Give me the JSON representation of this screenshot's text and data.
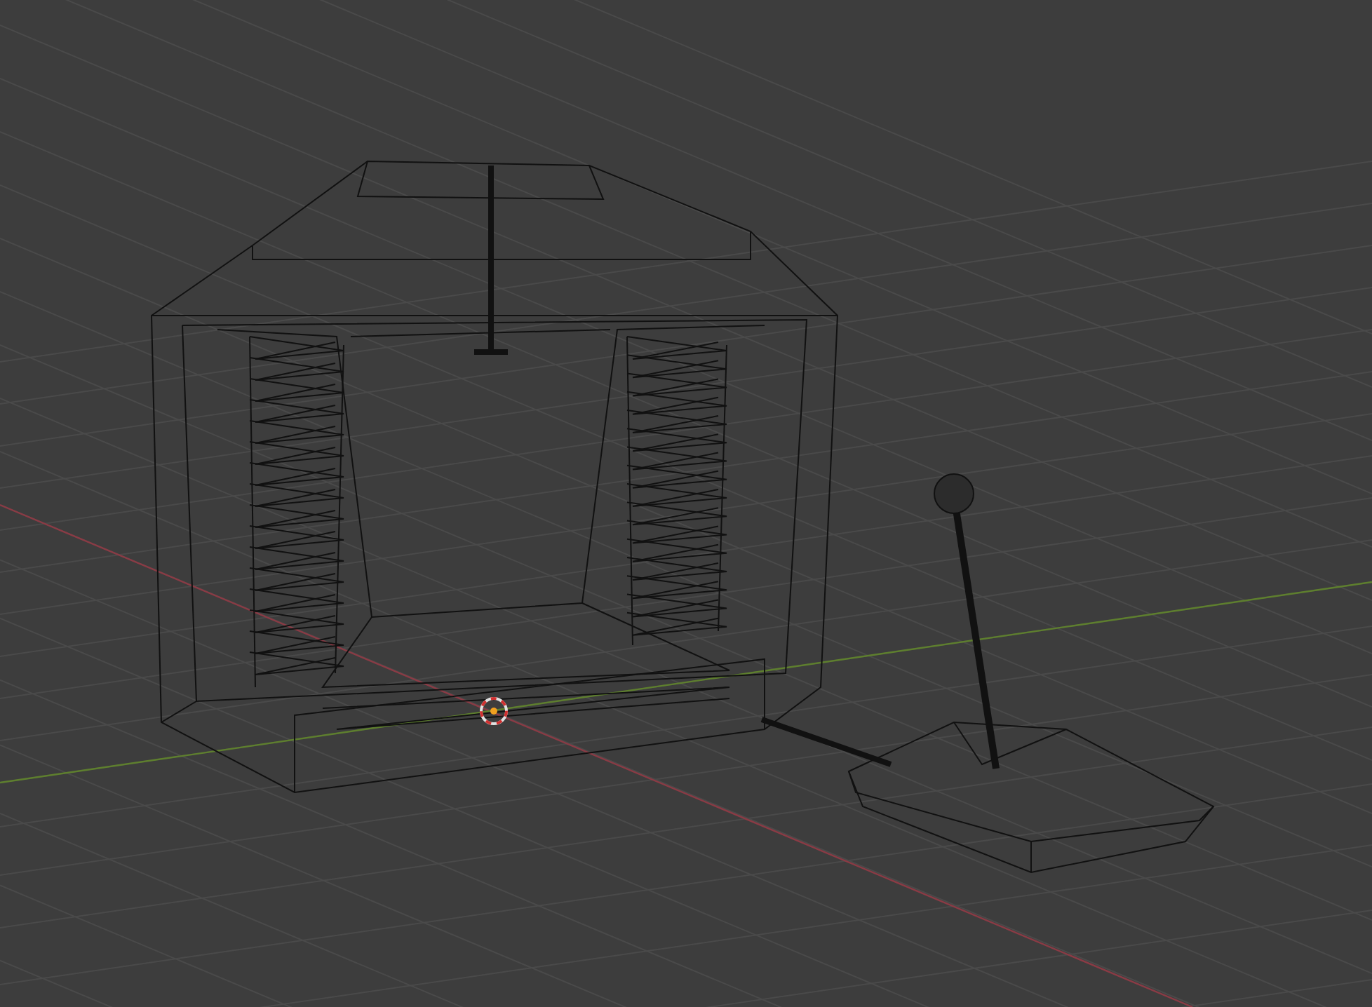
{
  "viewport": {
    "show_grid": true,
    "show_axes": true,
    "show_cursor": true
  },
  "objects": [
    {
      "kind": "gate"
    },
    {
      "kind": "lever"
    }
  ]
}
